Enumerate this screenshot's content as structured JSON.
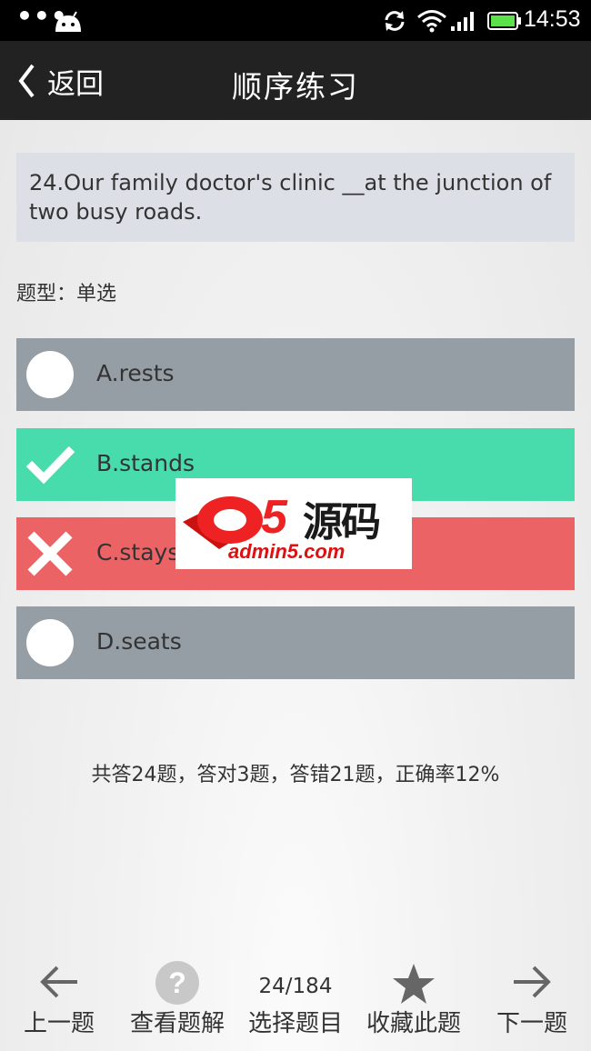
{
  "status_bar": {
    "dots": "•••",
    "time": "14:53",
    "icons": [
      "android-icon",
      "sync-icon",
      "wifi-icon",
      "signal-icon",
      "battery-icon"
    ]
  },
  "header": {
    "back_label": "返回",
    "title": "顺序练习",
    "background": "#222222"
  },
  "question": {
    "text": "24.Our family doctor's clinic __at the junction of two busy roads.",
    "type_label": "题型：单选"
  },
  "options": [
    {
      "label": "A.rests",
      "state": "unselected",
      "color": "#969ea5",
      "icon": "radio-circle-icon"
    },
    {
      "label": "B.stands",
      "state": "correct",
      "color": "#48dbab",
      "icon": "checkmark-icon"
    },
    {
      "label": "C.stays",
      "state": "wrong",
      "color": "#ec6366",
      "icon": "cross-icon"
    },
    {
      "label": "D.seats",
      "state": "unselected",
      "color": "#969ea5",
      "icon": "radio-circle-icon"
    }
  ],
  "stats_text": "共答24题，答对3题，答错21题，正确率12%",
  "watermark": {
    "chinese": "源码",
    "url": "admin5.com"
  },
  "toolbar": {
    "prev_label": "上一题",
    "explain_label": "查看题解",
    "progress": "24/184",
    "select_label": "选择题目",
    "favorite_label": "收藏此题",
    "next_label": "下一题"
  }
}
